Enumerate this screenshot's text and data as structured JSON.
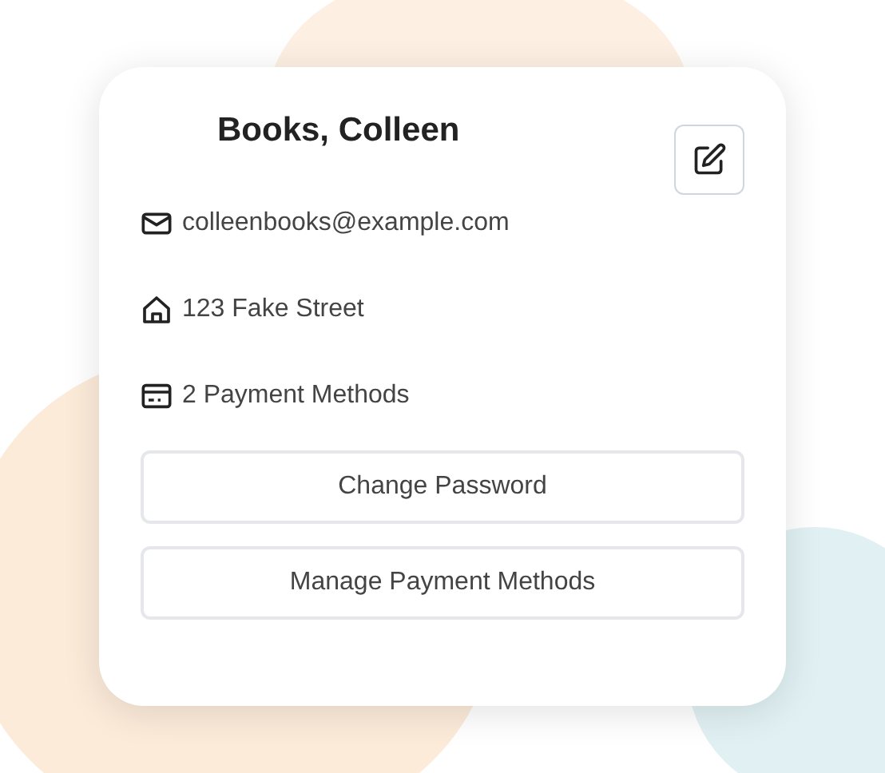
{
  "card": {
    "title": "Books, Colleen",
    "details": [
      {
        "kind": "email",
        "text": "colleenbooks@example.com"
      },
      {
        "kind": "address",
        "text": "123 Fake Street"
      },
      {
        "kind": "payment",
        "text": "2 Payment Methods"
      }
    ],
    "buttons": [
      "Change Password",
      "Manage Payment Methods"
    ]
  }
}
